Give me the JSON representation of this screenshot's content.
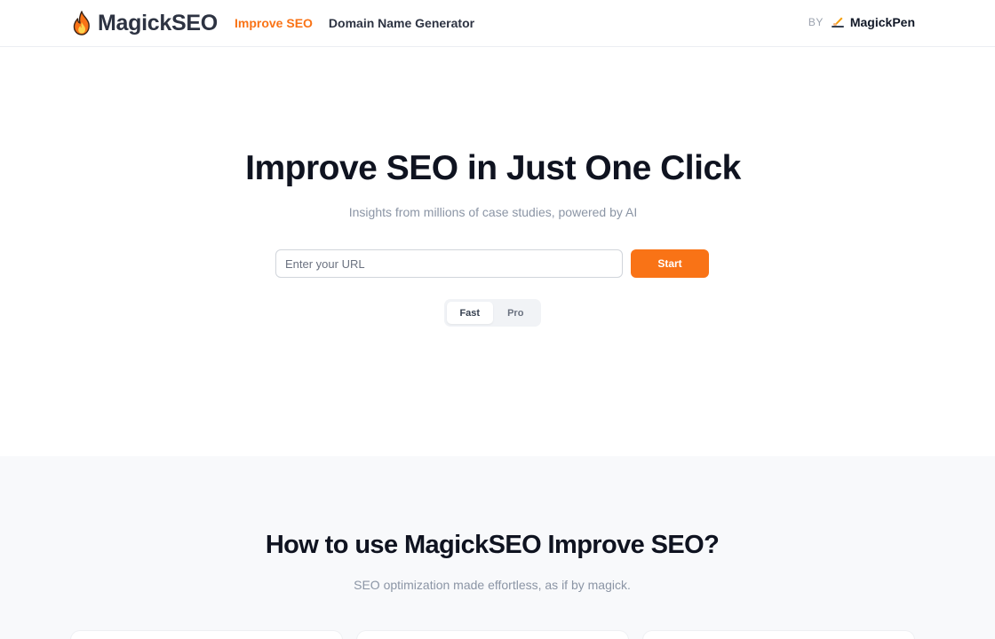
{
  "header": {
    "brand": "MagickSEO",
    "nav": [
      {
        "label": "Improve SEO",
        "active": true
      },
      {
        "label": "Domain Name Generator",
        "active": false
      }
    ],
    "by_label": "BY",
    "by_name": "MagickPen"
  },
  "hero": {
    "title": "Improve SEO in Just One Click",
    "subtitle": "Insights from millions of case studies, powered by AI",
    "url_placeholder": "Enter your URL",
    "url_value": "",
    "start_label": "Start",
    "modes": [
      {
        "label": "Fast",
        "selected": true
      },
      {
        "label": "Pro",
        "selected": false
      }
    ]
  },
  "how": {
    "title": "How to use MagickSEO Improve SEO?",
    "subtitle": "SEO optimization made effortless, as if by magick."
  },
  "colors": {
    "accent": "#f97316",
    "heading": "#0f1320",
    "muted": "#8b95a5",
    "section_bg": "#f8f9fb"
  }
}
